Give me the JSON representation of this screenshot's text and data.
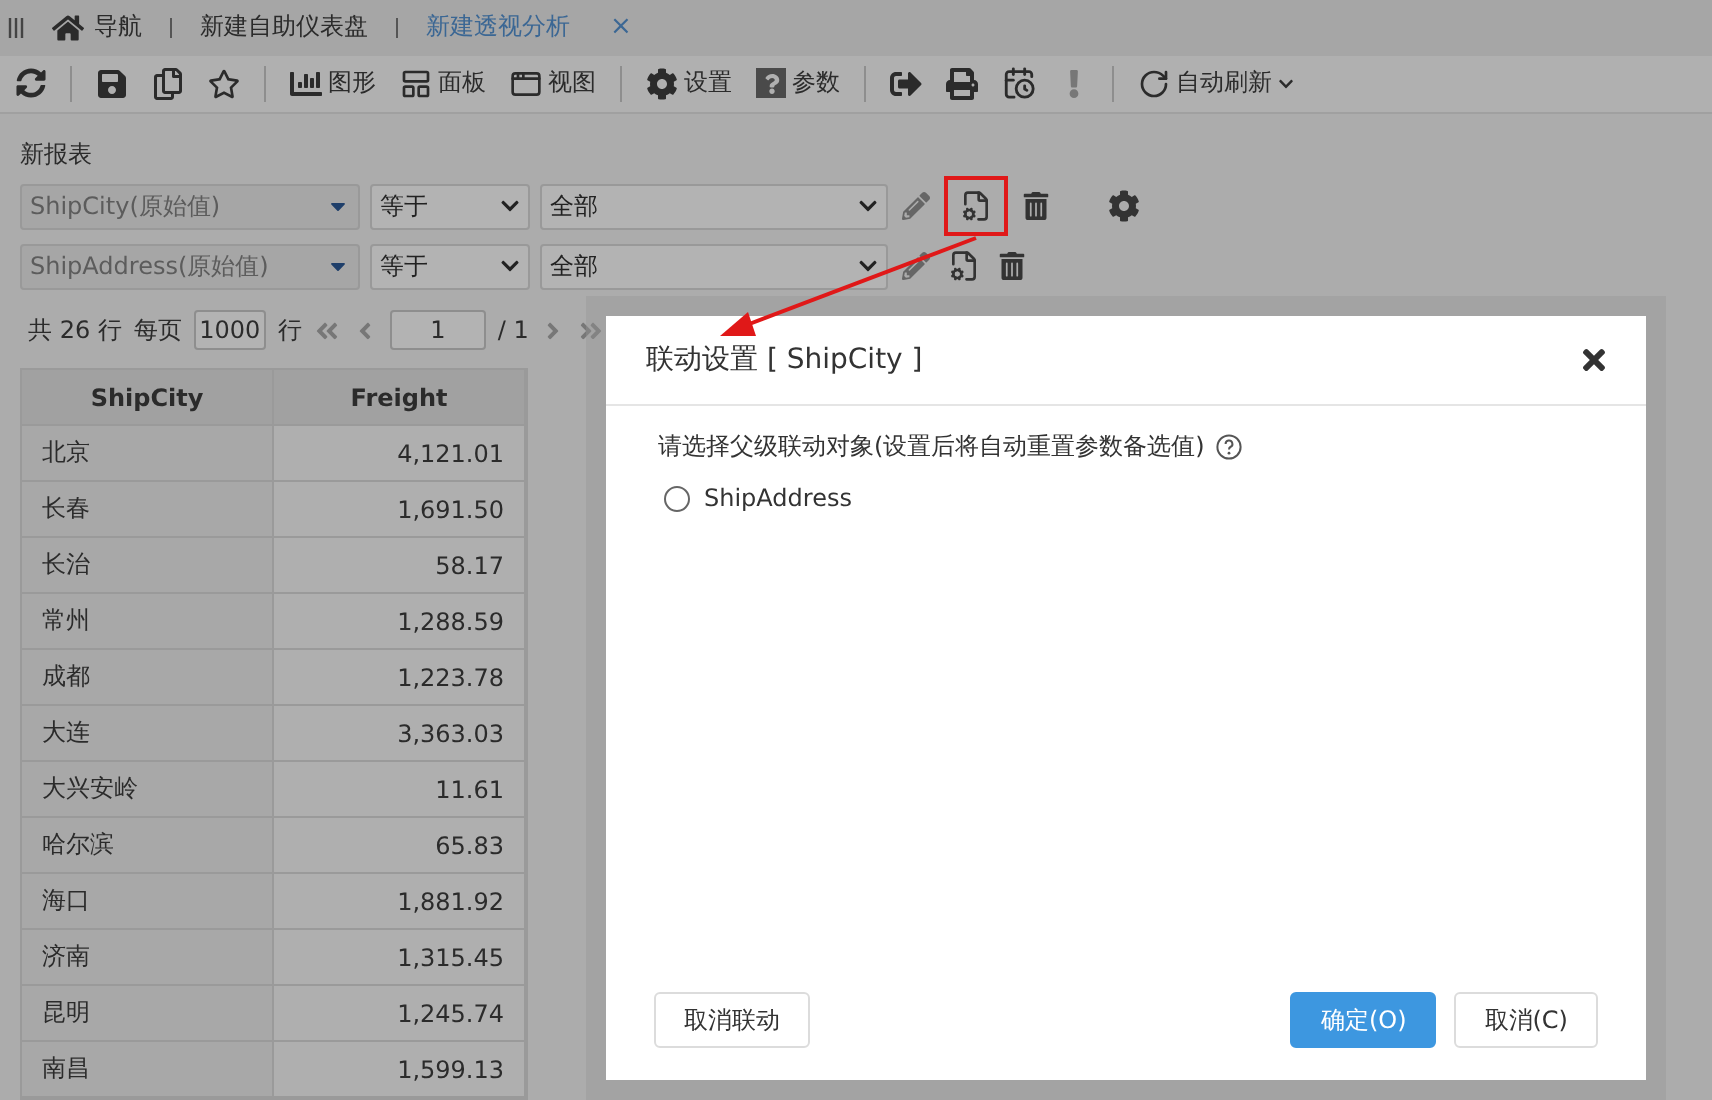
{
  "nav_tabs": [
    {
      "kind": "home",
      "label": "导航",
      "selected": false
    },
    {
      "kind": "plain",
      "label": "新建自助仪表盘",
      "selected": false
    },
    {
      "kind": "closable",
      "label": "新建透视分析",
      "selected": true,
      "close": "×"
    }
  ],
  "toolbar": [
    {
      "kind": "icon"
    },
    {
      "kind": "separator"
    },
    {
      "kind": "icon"
    },
    {
      "kind": "icon"
    },
    {
      "kind": "icon"
    },
    {
      "kind": "separator"
    },
    {
      "kind": "labeled",
      "label": "图形"
    },
    {
      "kind": "labeled",
      "label": "面板"
    },
    {
      "kind": "labeled",
      "label": "视图"
    },
    {
      "kind": "separator"
    },
    {
      "kind": "labeled",
      "label": "设置"
    },
    {
      "kind": "labeled",
      "label": "参数"
    },
    {
      "kind": "separator"
    },
    {
      "kind": "icon"
    },
    {
      "kind": "icon"
    },
    {
      "kind": "icon"
    },
    {
      "kind": "icon"
    },
    {
      "kind": "separator"
    },
    {
      "kind": "dropdown",
      "label": "自动刷新"
    }
  ],
  "report": {
    "title": "新报表",
    "filters": [
      {
        "field": "ShipCity(原始值)",
        "operator": "等于",
        "value": "全部",
        "annotated": true,
        "settings": true
      },
      {
        "field": "ShipAddress(原始值)",
        "operator": "等于",
        "value": "全部",
        "annotated": false,
        "settings": false
      }
    ],
    "pager": {
      "total": "共 26 行",
      "per_page_label": "每页",
      "per_page": "1000",
      "rows_unit": "行",
      "page": "1",
      "page_total": "/ 1"
    },
    "table": {
      "columns": [
        "ShipCity",
        "Freight"
      ],
      "rows": [
        [
          "北京",
          "4,121.01"
        ],
        [
          "长春",
          "1,691.50"
        ],
        [
          "长治",
          "58.17"
        ],
        [
          "常州",
          "1,288.59"
        ],
        [
          "成都",
          "1,223.78"
        ],
        [
          "大连",
          "3,363.03"
        ],
        [
          "大兴安岭",
          "11.61"
        ],
        [
          "哈尔滨",
          "65.83"
        ],
        [
          "海口",
          "1,881.92"
        ],
        [
          "济南",
          "1,315.45"
        ],
        [
          "昆明",
          "1,245.74"
        ],
        [
          "南昌",
          "1,599.13"
        ]
      ]
    }
  },
  "dialog": {
    "title": "联动设置 [ ShipCity ]",
    "prompt": "请选择父级联动对象(设置后将自动重置参数备选值)",
    "options": [
      {
        "label": "ShipAddress",
        "selected": false
      }
    ],
    "buttons": [
      {
        "label": "取消联动",
        "kind": "default"
      },
      {
        "label": "确定(O)",
        "kind": "primary"
      },
      {
        "label": "取消(C)",
        "kind": "default"
      }
    ]
  }
}
